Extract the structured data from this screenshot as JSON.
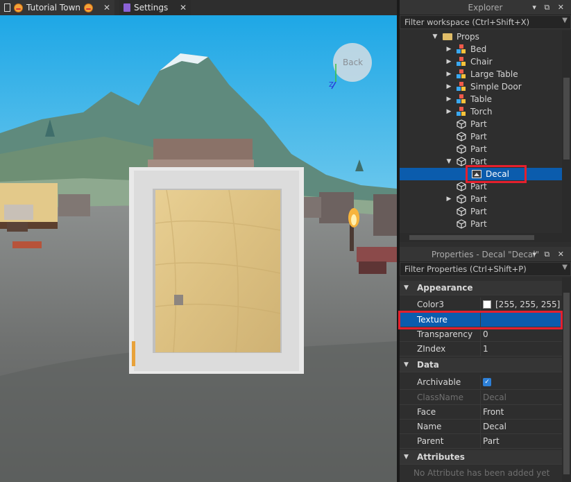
{
  "tabs": [
    {
      "label": "Tutorial Town",
      "close": "✕"
    },
    {
      "label": "Settings",
      "close": "✕"
    }
  ],
  "viewport": {
    "view_cube_label": "Back"
  },
  "explorer": {
    "title": "Explorer",
    "controls": "▾ ⧉ ✕",
    "filter_placeholder": "Filter workspace (Ctrl+Shift+X)",
    "items": [
      {
        "label": "Props",
        "icon": "folder-icon",
        "arrow": "▼"
      },
      {
        "label": "Bed",
        "icon": "model-icon",
        "arrow": "▶"
      },
      {
        "label": "Chair",
        "icon": "model-icon",
        "arrow": "▶"
      },
      {
        "label": "Large Table",
        "icon": "model-icon",
        "arrow": "▶"
      },
      {
        "label": "Simple Door",
        "icon": "model-icon",
        "arrow": "▶"
      },
      {
        "label": "Table",
        "icon": "model-icon",
        "arrow": "▶"
      },
      {
        "label": "Torch",
        "icon": "model-icon",
        "arrow": "▶"
      },
      {
        "label": "Part",
        "icon": "part-icon",
        "arrow": ""
      },
      {
        "label": "Part",
        "icon": "part-icon",
        "arrow": ""
      },
      {
        "label": "Part",
        "icon": "part-icon",
        "arrow": ""
      },
      {
        "label": "Part",
        "icon": "part-icon",
        "arrow": "▼"
      },
      {
        "label": "Decal",
        "icon": "decal-icon",
        "arrow": ""
      },
      {
        "label": "Part",
        "icon": "part-icon",
        "arrow": ""
      },
      {
        "label": "Part",
        "icon": "part-icon",
        "arrow": "▶"
      },
      {
        "label": "Part",
        "icon": "part-icon",
        "arrow": ""
      },
      {
        "label": "Part",
        "icon": "part-icon",
        "arrow": ""
      }
    ]
  },
  "properties": {
    "title": "Properties - Decal \"Decal\"",
    "controls": "▾ ⧉ ✕",
    "filter_placeholder": "Filter Properties (Ctrl+Shift+P)",
    "sections": {
      "appearance": "Appearance",
      "data": "Data",
      "attributes": "Attributes"
    },
    "rows": {
      "color3_name": "Color3",
      "color3_value": "[255, 255, 255]",
      "texture_name": "Texture",
      "texture_value": "",
      "transparency_name": "Transparency",
      "transparency_value": "0",
      "zindex_name": "ZIndex",
      "zindex_value": "1",
      "archivable_name": "Archivable",
      "archivable_check": "✓",
      "classname_name": "ClassName",
      "classname_value": "Decal",
      "face_name": "Face",
      "face_value": "Front",
      "name_name": "Name",
      "name_value": "Decal",
      "parent_name": "Parent",
      "parent_value": "Part",
      "attributes_empty": "No Attribute has been added yet"
    }
  },
  "colors": {
    "selection": "#0b5cad",
    "highlight": "#e4202e"
  }
}
